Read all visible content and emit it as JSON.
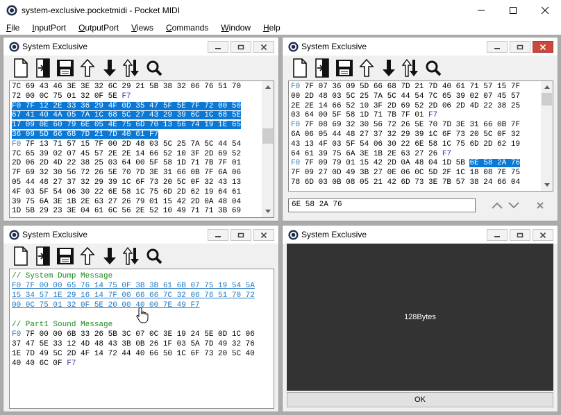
{
  "app": {
    "title": "system-exclusive.pocketmidi - Pocket MIDI"
  },
  "menu": [
    {
      "label": "File",
      "key": "F",
      "rest": "ile"
    },
    {
      "label": "InputPort",
      "key": "I",
      "rest": "nputPort"
    },
    {
      "label": "OutputPort",
      "key": "O",
      "rest": "utputPort"
    },
    {
      "label": "Views",
      "key": "V",
      "rest": "iews"
    },
    {
      "label": "Commands",
      "key": "C",
      "rest": "ommands"
    },
    {
      "label": "Window",
      "key": "W",
      "rest": "indow"
    },
    {
      "label": "Help",
      "key": "H",
      "rest": "elp"
    }
  ],
  "windows": {
    "top_left": {
      "title": "System Exclusive",
      "lines": [
        [
          {
            "t": "7C 69 43 46 3E 3E 32 6C 29 21 5B 38 32 06 76 51 70"
          }
        ],
        [
          {
            "t": "72 00 0C 75 01 32 0F 5E "
          },
          {
            "t": "F7",
            "c": "f7"
          }
        ],
        [
          {
            "t": "F0 7F 12 2E 33 36 29 4F 0D 35 47 5F 5E 7F 72 00 50",
            "c": "hl"
          }
        ],
        [
          {
            "t": "67 41 40 4A 05 7A 1C 68 5C 27 43 29 39 6C 1C 68 5E",
            "c": "hl"
          }
        ],
        [
          {
            "t": "17 09 0E 60 79 6E 05 4E 75 6D 70 13 56 74 19 1E 65",
            "c": "hl"
          }
        ],
        [
          {
            "t": "36 09 5D 66 68 7D 21 7D 40 61 F7",
            "c": "hl"
          }
        ],
        [
          {
            "t": "F0",
            "c": "f0"
          },
          {
            "t": " 7F 13 71 57 15 7F 00 2D 48 03 5C 25 7A 5C 44 54"
          }
        ],
        [
          {
            "t": "7C 65 39 02 07 45 57 2E 2E 14 66 52 10 3F 2D 69 52"
          }
        ],
        [
          {
            "t": "2D 06 2D 4D 22 38 25 03 64 00 5F 58 1D 71 7B 7F 01"
          }
        ],
        [
          {
            "t": "7F 69 32 30 56 72 26 5E 70 7D 3E 31 66 0B 7F 6A 06"
          }
        ],
        [
          {
            "t": "05 44 48 27 37 32 29 39 1C 6F 73 20 5C 0F 32 43 13"
          }
        ],
        [
          {
            "t": "4F 03 5F 54 06 30 22 6E 58 1C 75 6D 2D 62 19 64 61"
          }
        ],
        [
          {
            "t": "39 75 6A 3E 1B 2E 63 27 26 79 01 15 42 2D 0A 48 04"
          }
        ],
        [
          {
            "t": "1D 5B 29 23 3E 04 61 6C 56 2E 52 10 49 71 71 3B 69"
          }
        ]
      ]
    },
    "top_right": {
      "title": "System Exclusive",
      "lines": [
        [
          {
            "t": "F0",
            "c": "f0"
          },
          {
            "t": " 7F 07 36 09 5D 66 68 7D 21 7D 40 61 71 57 15 7F"
          }
        ],
        [
          {
            "t": "00 2D 48 03 5C 25 7A 5C 44 54 7C 65 39 02 07 45 57"
          }
        ],
        [
          {
            "t": "2E 2E 14 66 52 10 3F 2D 69 52 2D 06 2D 4D 22 38 25"
          }
        ],
        [
          {
            "t": "03 64 00 5F 58 1D 71 7B 7F 01 "
          },
          {
            "t": "F7",
            "c": "f7"
          }
        ],
        [
          {
            "t": "F0",
            "c": "f0"
          },
          {
            "t": " 7F 08 69 32 30 56 72 26 5E 70 7D 3E 31 66 0B 7F"
          }
        ],
        [
          {
            "t": "6A 06 05 44 48 27 37 32 29 39 1C 6F 73 20 5C 0F 32"
          }
        ],
        [
          {
            "t": "43 13 4F 03 5F 54 06 30 22 6E 58 1C 75 6D 2D 62 19"
          }
        ],
        [
          {
            "t": "64 61 39 75 6A 3E 1B 2E 63 27 26 "
          },
          {
            "t": "F7",
            "c": "f7"
          }
        ],
        [
          {
            "t": "F0",
            "c": "f0"
          },
          {
            "t": " 7F 09 79 01 15 42 2D 0A 48 04 1D 5B "
          },
          {
            "t": "6E 58 2A 76",
            "c": "hl"
          }
        ],
        [
          {
            "t": "7F 09 27 0D 49 3B 27 0E 06 0C 5D 2F 1C 18 08 7E 75"
          }
        ],
        [
          {
            "t": "78 6D 03 0B 08 05 21 42 6D 73 3E 7B 57 38 24 66 04"
          }
        ]
      ],
      "search_value": "6E 58 2A 76"
    },
    "bottom_left": {
      "title": "System Exclusive",
      "lines": [
        [
          {
            "t": "// System Dump Message",
            "c": "comment"
          }
        ],
        [
          {
            "t": "F0 7F 00 00 65 76 14 75 0F 3B 3B 61 6B 07 75 19 54 5A",
            "c": "link"
          }
        ],
        [
          {
            "t": "15 34 57 1E 29 16 14 7F 00 66 66 7C 32 06 76 51 70 72",
            "c": "link"
          }
        ],
        [
          {
            "t": "00 0C 75 01 32 0F 5E 20 00 40 00 7E 49 F7",
            "c": "link"
          }
        ],
        [
          {
            "t": ""
          }
        ],
        [
          {
            "t": "// Part1 Sound Message",
            "c": "comment"
          }
        ],
        [
          {
            "t": "F0",
            "c": "f0"
          },
          {
            "t": " 7F 00 00 6B 33 26 5B 3C 07 0C 3E 19 24 5E 0D 1C 06"
          }
        ],
        [
          {
            "t": "37 47 5E 33 12 4D 48 43 3B 0B 26 1F 03 5A 7D 49 32 76"
          }
        ],
        [
          {
            "t": "1E 7D 49 5C 2D 4F 14 72 44 40 66 50 1C 6F 73 20 5C 40"
          }
        ],
        [
          {
            "t": "40 40 6C 0F "
          },
          {
            "t": "F7",
            "c": "f7"
          }
        ]
      ]
    },
    "bottom_right": {
      "title": "System Exclusive",
      "size_label": "128Bytes",
      "ok_label": "OK"
    }
  },
  "colors": {
    "selection": "#0a78d4",
    "mdi_background": "#ababab",
    "comment": "#1a8a1a",
    "link": "#2277c0",
    "panel_dark": "#333333"
  }
}
